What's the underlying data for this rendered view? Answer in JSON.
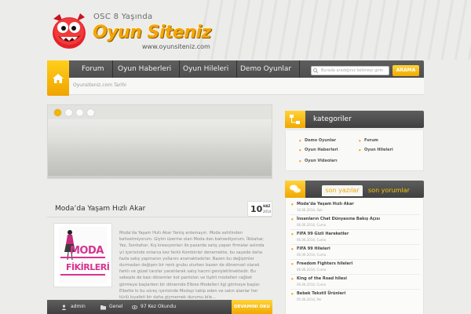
{
  "header": {
    "tagline": "OSC 8 Yaşında",
    "site_name": "Oyun Siteniz",
    "site_url": "www.oyunsiteniz.com"
  },
  "nav": {
    "items": [
      "Forum",
      "Oyun Haberleri",
      "Oyun Hileleri",
      "Demo Oyunlar"
    ],
    "breadcrumb": "Oyunsiteniz.com Tarihi",
    "search_placeholder": "Burada aradığınız kelimeyi girin",
    "search_button": "ARAMA"
  },
  "slider": {
    "dots": 4,
    "active_dot": 0
  },
  "post": {
    "title": "Moda’da Yaşam Hızlı Akar",
    "date_day": "10",
    "date_month": "HAZ",
    "date_year": "2014",
    "thumb_word1": "MODA",
    "thumb_word2": "FİKİRLERİ",
    "excerpt": "Moda’da Yaşam Hızlı Akar Yanlış anlamayın. Moda sahilinden bahsetmiyorum. Giyim üzerine olan Moda dan bahsediyorum. İlkbahar, Yaz, Sonbahar, Kış kreasyonları ile pazarda satış yapan firmalar aslında yıl içerisinde onlarca kez farklı Kombinler denemekte, bu sayede daha fazla satış yapmanın yollarını aramaktadırlar. Bazen bu değişimler durmadan değişen bir renk grubu olurken bazen de dönemsel olarak farklı ve güzel tarzlar yaratılarak satış hacmi genişletilmektedir. Bu sebeple de bazı dönemler kot pantolon ve tişört modelleri rağbet görmeye başlarken bir dönemde Elbise Modelleri ilgi görmeye başlar. Elbette ki bu süreç içerisinde Modayı takip eden ve satın alanlar her türlü kıyafeti bir daha giymemek durumu bile...",
    "author": "admin",
    "category": "Genel",
    "reads": "97 Kez Okundu",
    "more_button": "DEVAMINI OKU"
  },
  "sidebar": {
    "categories_title": "kategoriler",
    "categories": [
      "Demo Oyunlar",
      "Forum",
      "Oyun Haberleri",
      "Oyun Hileleri",
      "Oyun Videoları"
    ],
    "tab_posts": "son yazılar",
    "tab_comments": "son yorumlar",
    "recent": [
      {
        "title": "Moda’da Yaşam Hızlı Akar",
        "date": "10.06.2014, Salı"
      },
      {
        "title": "İnsanların Chat Dünyasına Bakış Açısı",
        "date": "06.06.2014, Cuma"
      },
      {
        "title": "FIFA 99 Gizli Hareketler",
        "date": "06.06.2014, Cuma"
      },
      {
        "title": "FIFA 99 Hileleri",
        "date": "06.06.2014, Cuma"
      },
      {
        "title": "Freedom Fighters hileleri",
        "date": "06.06.2014, Cuma"
      },
      {
        "title": "King of the Road hilesi",
        "date": "06.06.2014, Cuma"
      },
      {
        "title": "Bebek Tekstil Ürünleri",
        "date": "05.06.2014, Per"
      }
    ]
  },
  "colors": {
    "accent": "#f0a800",
    "nav_dark": "#454545",
    "brand_pink": "#d8338f"
  }
}
